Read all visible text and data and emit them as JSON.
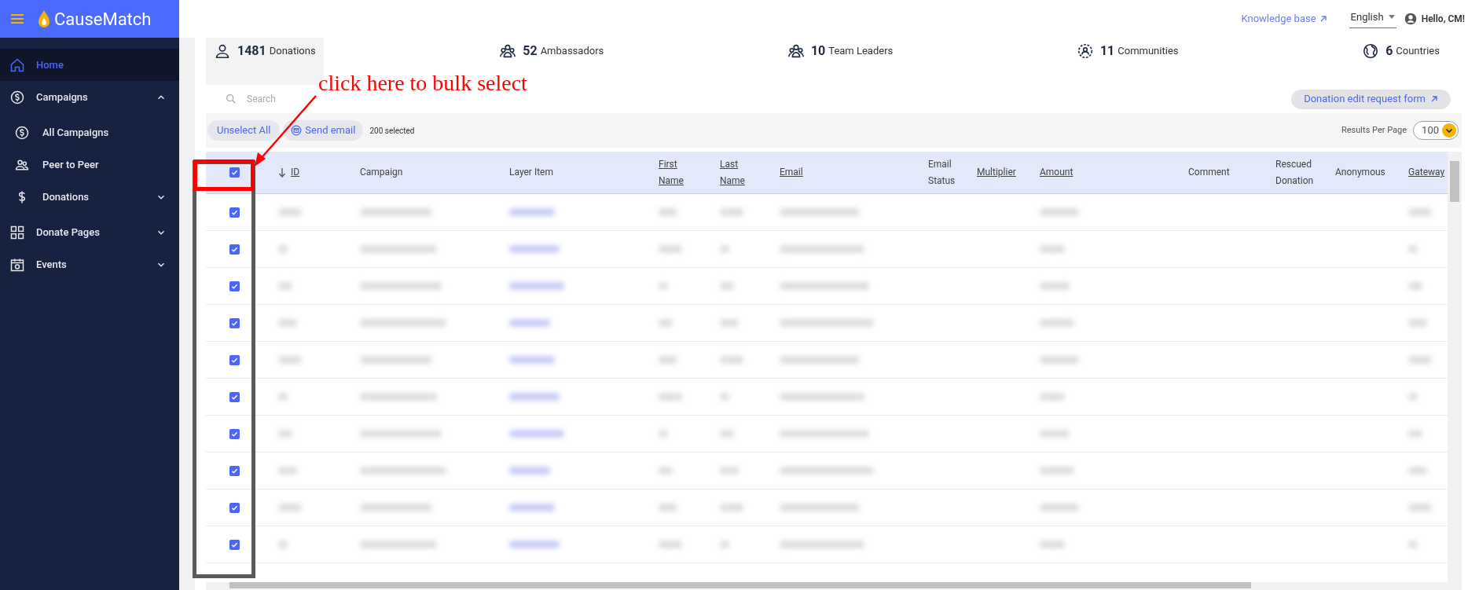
{
  "brand": {
    "name": "CauseMatch"
  },
  "sidebar": {
    "items": [
      {
        "label": "Home",
        "selected": true
      },
      {
        "label": "Campaigns",
        "selected": false,
        "expanded": true,
        "children": [
          {
            "label": "All Campaigns",
            "selected": false
          },
          {
            "label": "Peer to Peer",
            "selected": false
          },
          {
            "label": "Donations",
            "selected": false,
            "expanded": false
          }
        ]
      },
      {
        "label": "Donate Pages",
        "selected": false,
        "expanded": false
      },
      {
        "label": "Events",
        "selected": false,
        "expanded": false
      }
    ]
  },
  "topbar": {
    "link": "Knowledge base",
    "language": "English",
    "greeting": "Hello, CM!"
  },
  "stats": [
    {
      "value": "1481",
      "label": "Donations",
      "selected": true
    },
    {
      "value": "52",
      "label": "Ambassadors",
      "selected": false
    },
    {
      "value": "10",
      "label": "Team Leaders",
      "selected": false
    },
    {
      "value": "11",
      "label": "Communities",
      "selected": false
    },
    {
      "value": "6",
      "label": "Countries",
      "selected": false
    }
  ],
  "search": {
    "placeholder": "Search"
  },
  "request_button": "Donation edit request form",
  "toolbar": {
    "unselect": "Unselect All",
    "send_email": "Send email",
    "count": "200 selected",
    "per_page_label": "Results Per Page",
    "per_page": "100"
  },
  "table": {
    "all_checked": true,
    "columns": [
      {
        "label": "ID",
        "sortable": true,
        "sorted": true
      },
      {
        "label": "Campaign",
        "sortable": false,
        "sorted": false
      },
      {
        "label": "Layer Item",
        "sortable": false,
        "sorted": false
      },
      {
        "label": "First Name",
        "sortable": true,
        "sorted": false
      },
      {
        "label": "Last Name",
        "sortable": true,
        "sorted": false
      },
      {
        "label": "Email",
        "sortable": true,
        "sorted": false
      },
      {
        "label": "Email Status",
        "sortable": false,
        "sorted": false
      },
      {
        "label": "Multiplier",
        "sortable": true,
        "sorted": false
      },
      {
        "label": "Amount",
        "sortable": true,
        "sorted": false
      },
      {
        "label": "Comment",
        "sortable": false,
        "sorted": false
      },
      {
        "label": "Rescued Donation",
        "sortable": false,
        "sorted": false
      },
      {
        "label": "Anonymous",
        "sortable": false,
        "sorted": false
      },
      {
        "label": "Gateway",
        "sortable": true,
        "sorted": false
      }
    ],
    "rows": [
      {
        "checked": true
      },
      {
        "checked": true
      },
      {
        "checked": true
      },
      {
        "checked": true
      },
      {
        "checked": true
      },
      {
        "checked": true
      },
      {
        "checked": true
      },
      {
        "checked": true
      },
      {
        "checked": true
      },
      {
        "checked": true
      }
    ]
  },
  "annotation": {
    "text": "click here to bulk select"
  }
}
